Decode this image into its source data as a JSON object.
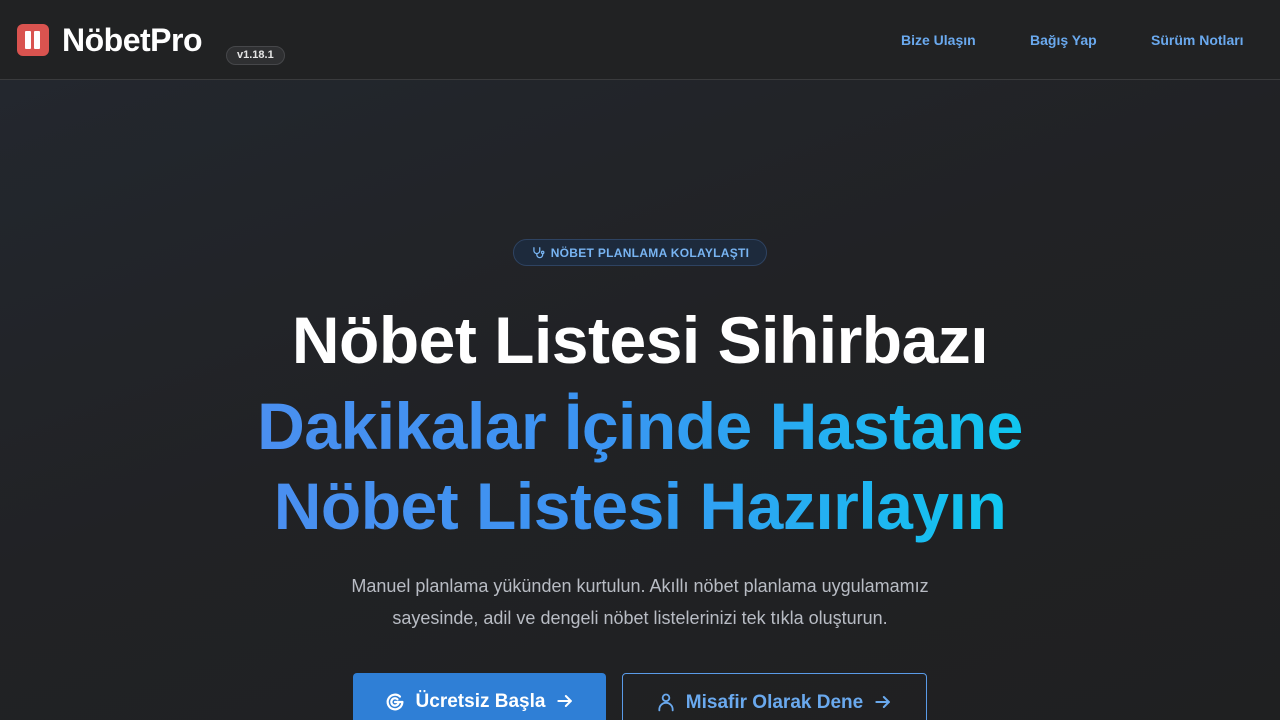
{
  "header": {
    "brand": "NöbetPro",
    "version": "v1.18.1",
    "nav": [
      {
        "label": "Bize Ulaşın"
      },
      {
        "label": "Bağış Yap"
      },
      {
        "label": "Sürüm Notları"
      }
    ],
    "logo_icon": "logo-columns-icon"
  },
  "hero": {
    "badge": {
      "icon": "stethoscope-icon",
      "label": "NÖBET PLANLAMA KOLAYLAŞTI"
    },
    "title_line1": "Nöbet Listesi Sihirbazı",
    "title_line2": "Dakikalar İçinde Hastane",
    "title_line3": "Nöbet Listesi Hazırlayın",
    "description_line1": "Manuel planlama yükünden kurtulun. Akıllı nöbet planlama uygulamamız",
    "description_line2": "sayesinde, adil ve dengeli nöbet listelerinizi tek tıkla oluşturun.",
    "primary_button": {
      "label": "Ücretsiz Başla",
      "icon": "google-icon",
      "trailing_icon": "arrow-right-icon"
    },
    "secondary_button": {
      "label": "Misafir Olarak Dene",
      "icon": "user-icon",
      "trailing_icon": "arrow-right-icon"
    }
  },
  "colors": {
    "accent": "#2f7fd6",
    "link": "#6aa9ee",
    "logo": "#d9534f",
    "gradient_start": "#4a8ff0",
    "gradient_end": "#10c7f0"
  }
}
